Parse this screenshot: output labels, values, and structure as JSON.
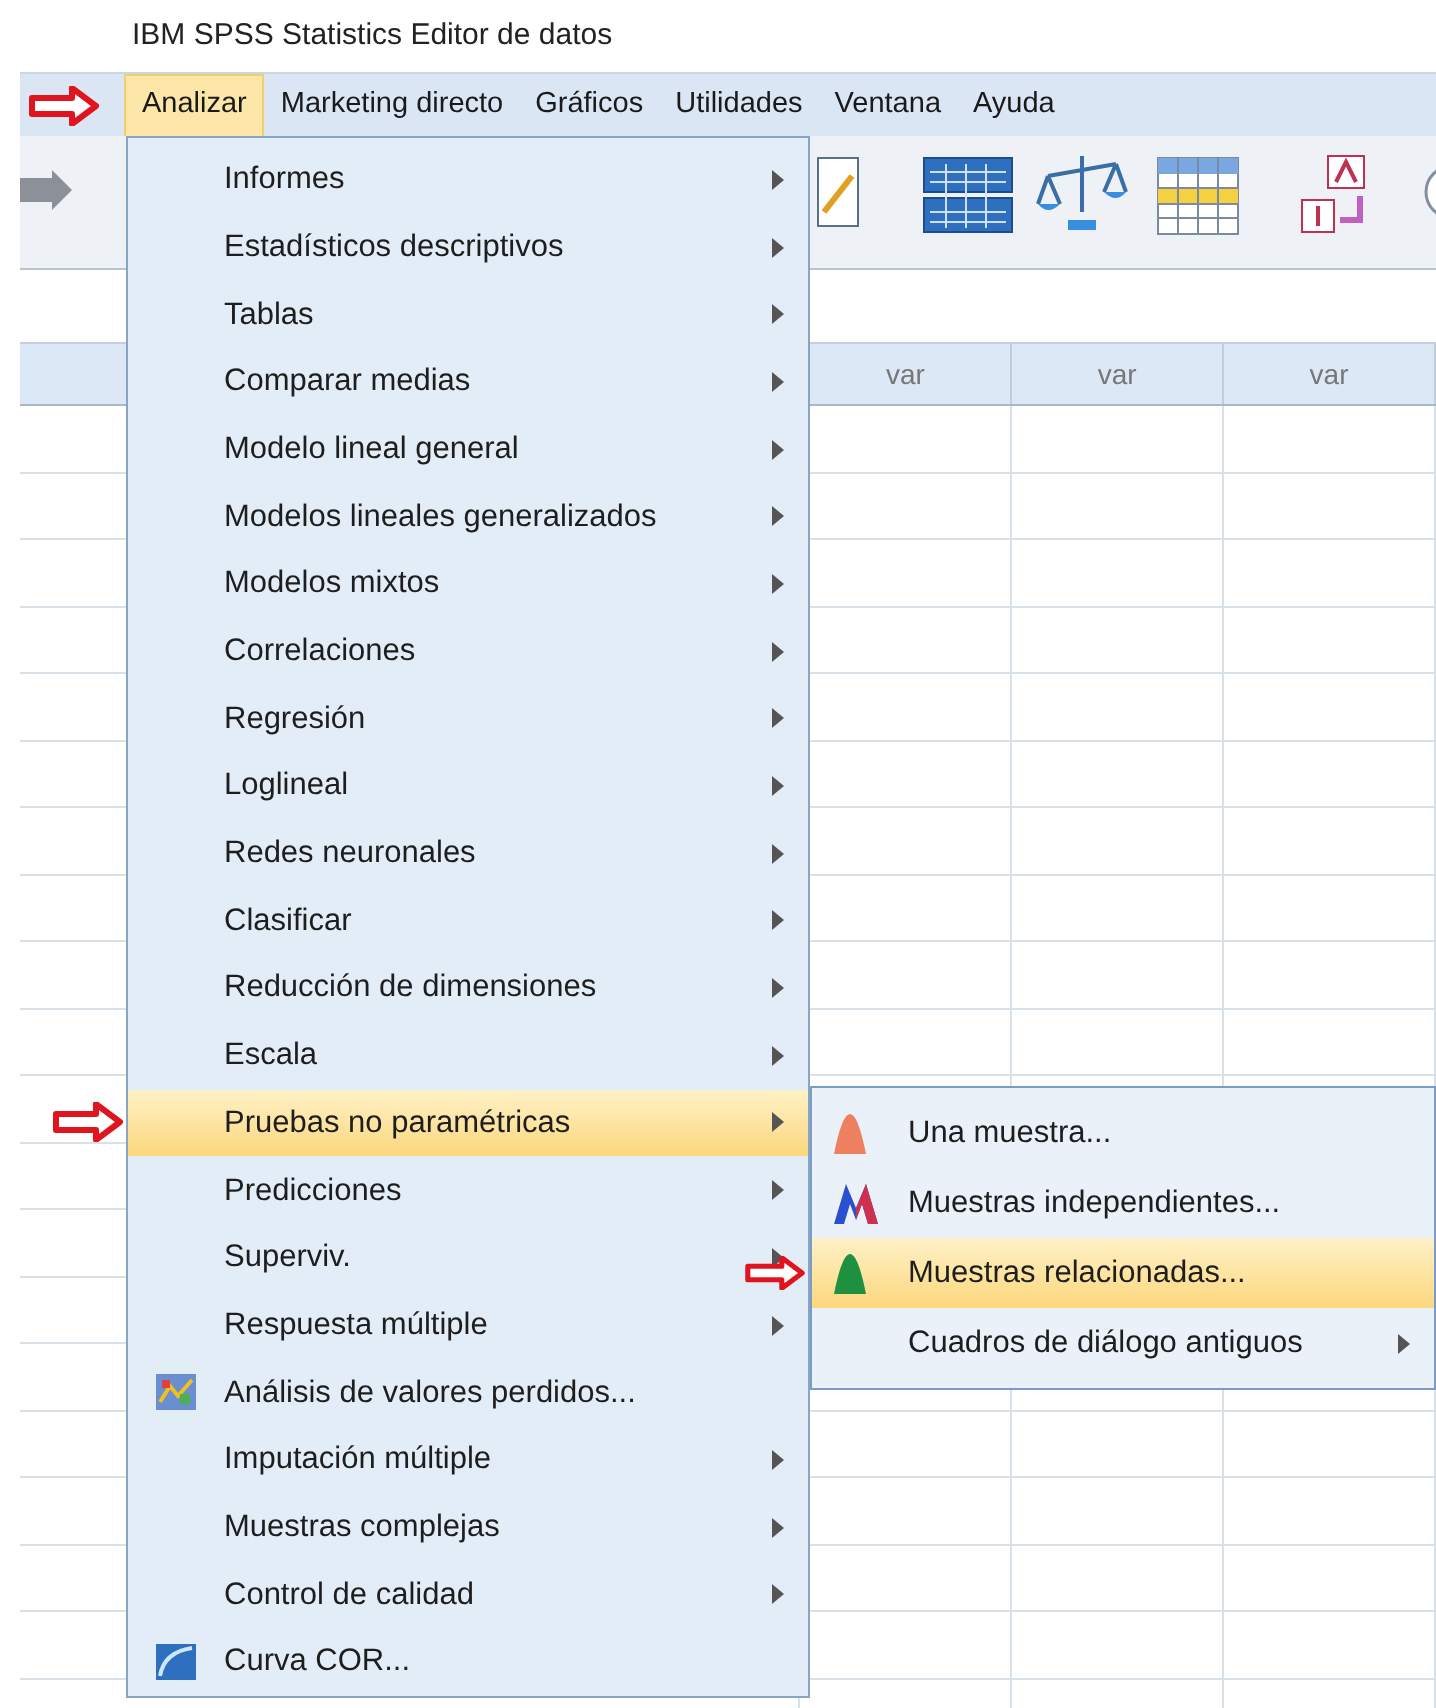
{
  "window": {
    "title": "IBM SPSS Statistics Editor de datos"
  },
  "menubar": [
    {
      "label": "Analizar",
      "selected": true
    },
    {
      "label": "Marketing directo",
      "selected": false
    },
    {
      "label": "Gráficos",
      "selected": false
    },
    {
      "label": "Utilidades",
      "selected": false
    },
    {
      "label": "Ventana",
      "selected": false
    },
    {
      "label": "Ayuda",
      "selected": false
    }
  ],
  "grid": {
    "columns": [
      "var",
      "var",
      "var"
    ]
  },
  "menu": [
    {
      "label": "Informes",
      "kind": "submenu",
      "selected": false
    },
    {
      "label": "Estadísticos descriptivos",
      "kind": "submenu",
      "selected": false
    },
    {
      "label": "Tablas",
      "kind": "submenu",
      "selected": false
    },
    {
      "label": "Comparar medias",
      "kind": "submenu",
      "selected": false
    },
    {
      "label": "Modelo lineal general",
      "kind": "submenu",
      "selected": false
    },
    {
      "label": "Modelos lineales generalizados",
      "kind": "submenu",
      "selected": false
    },
    {
      "label": "Modelos mixtos",
      "kind": "submenu",
      "selected": false
    },
    {
      "label": "Correlaciones",
      "kind": "submenu",
      "selected": false
    },
    {
      "label": "Regresión",
      "kind": "submenu",
      "selected": false
    },
    {
      "label": "Loglineal",
      "kind": "submenu",
      "selected": false
    },
    {
      "label": "Redes neuronales",
      "kind": "submenu",
      "selected": false
    },
    {
      "label": "Clasificar",
      "kind": "submenu",
      "selected": false
    },
    {
      "label": "Reducción de dimensiones",
      "kind": "submenu",
      "selected": false
    },
    {
      "label": "Escala",
      "kind": "submenu",
      "selected": false
    },
    {
      "label": "Pruebas no paramétricas",
      "kind": "submenu",
      "selected": true
    },
    {
      "label": "Predicciones",
      "kind": "submenu",
      "selected": false
    },
    {
      "label": "Superviv.",
      "kind": "submenu",
      "selected": false
    },
    {
      "label": "Respuesta múltiple",
      "kind": "submenu",
      "selected": false
    },
    {
      "label": "Análisis de valores perdidos...",
      "kind": "action",
      "selected": false
    },
    {
      "label": "Imputación múltiple",
      "kind": "submenu",
      "selected": false
    },
    {
      "label": "Muestras complejas",
      "kind": "submenu",
      "selected": false
    },
    {
      "label": "Control de calidad",
      "kind": "submenu",
      "selected": false
    },
    {
      "label": "Curva COR...",
      "kind": "action",
      "selected": false
    }
  ],
  "submenu": [
    {
      "label": "Una muestra...",
      "kind": "action",
      "selected": false
    },
    {
      "label": "Muestras independientes...",
      "kind": "action",
      "selected": false
    },
    {
      "label": "Muestras relacionadas...",
      "kind": "action",
      "selected": true
    },
    {
      "label": "Cuadros de diálogo antiguos",
      "kind": "submenu",
      "selected": false
    }
  ]
}
